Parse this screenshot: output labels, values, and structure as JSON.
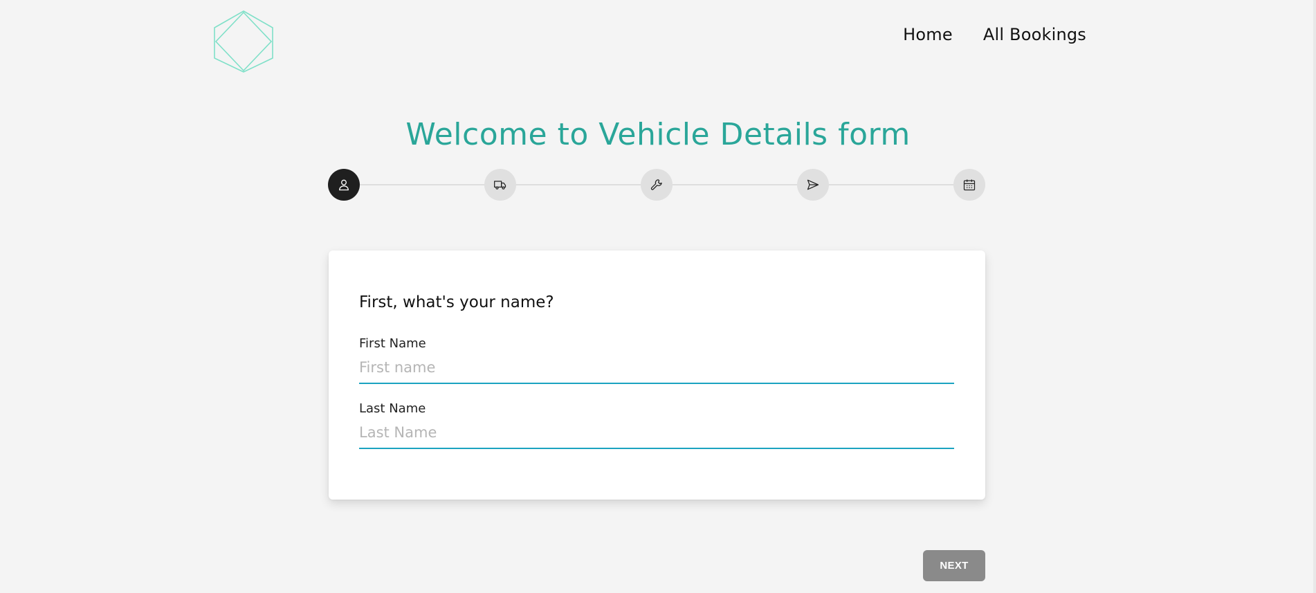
{
  "header": {
    "logo_icon": "hexagon-diamond-logo-icon",
    "nav": [
      {
        "label": "Home"
      },
      {
        "label": "All Bookings"
      }
    ]
  },
  "title": "Welcome to Vehicle Details form",
  "stepper": {
    "steps": [
      {
        "icon": "person-icon",
        "active": true
      },
      {
        "icon": "truck-icon",
        "active": false
      },
      {
        "icon": "wrench-icon",
        "active": false
      },
      {
        "icon": "send-icon",
        "active": false
      },
      {
        "icon": "calendar-icon",
        "active": false
      }
    ]
  },
  "form": {
    "question": "First, what's your name?",
    "first_name": {
      "label": "First Name",
      "placeholder": "First name",
      "value": ""
    },
    "last_name": {
      "label": "Last Name",
      "placeholder": "Last Name",
      "value": ""
    }
  },
  "actions": {
    "next_label": "NEXT"
  },
  "colors": {
    "accent": "#2aa699",
    "logo": "#7fe0c8",
    "input_underline": "#1aa3c0",
    "active_step": "#1f1f1f",
    "inactive_step": "#e0e0e0",
    "next_button": "#8a8a8a"
  }
}
